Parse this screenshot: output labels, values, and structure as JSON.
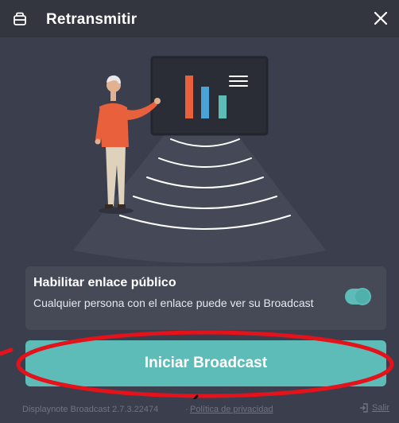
{
  "header": {
    "title": "Retransmitir",
    "close_symbol": "✕"
  },
  "public_link": {
    "title": "Habilitar enlace público",
    "description": "Cualquier persona con el enlace puede ver su Broadcast",
    "enabled": true
  },
  "primary_button": {
    "label": "Iniciar Broadcast"
  },
  "footer": {
    "version": "Displaynote Broadcast 2.7.3.22474",
    "separator": "·",
    "privacy_label": "Política de privacidad",
    "exit_label": "Salir"
  },
  "colors": {
    "background": "#3b3f4d",
    "header": "#33363f",
    "accent": "#5dbcb7",
    "annotation": "#e3121b",
    "bar_orange": "#e8603c",
    "bar_blue": "#4aa3d8",
    "bar_teal": "#5dbcb7"
  },
  "icons": {
    "header": "cast-icon",
    "close": "close-icon",
    "exit": "exit-icon"
  }
}
